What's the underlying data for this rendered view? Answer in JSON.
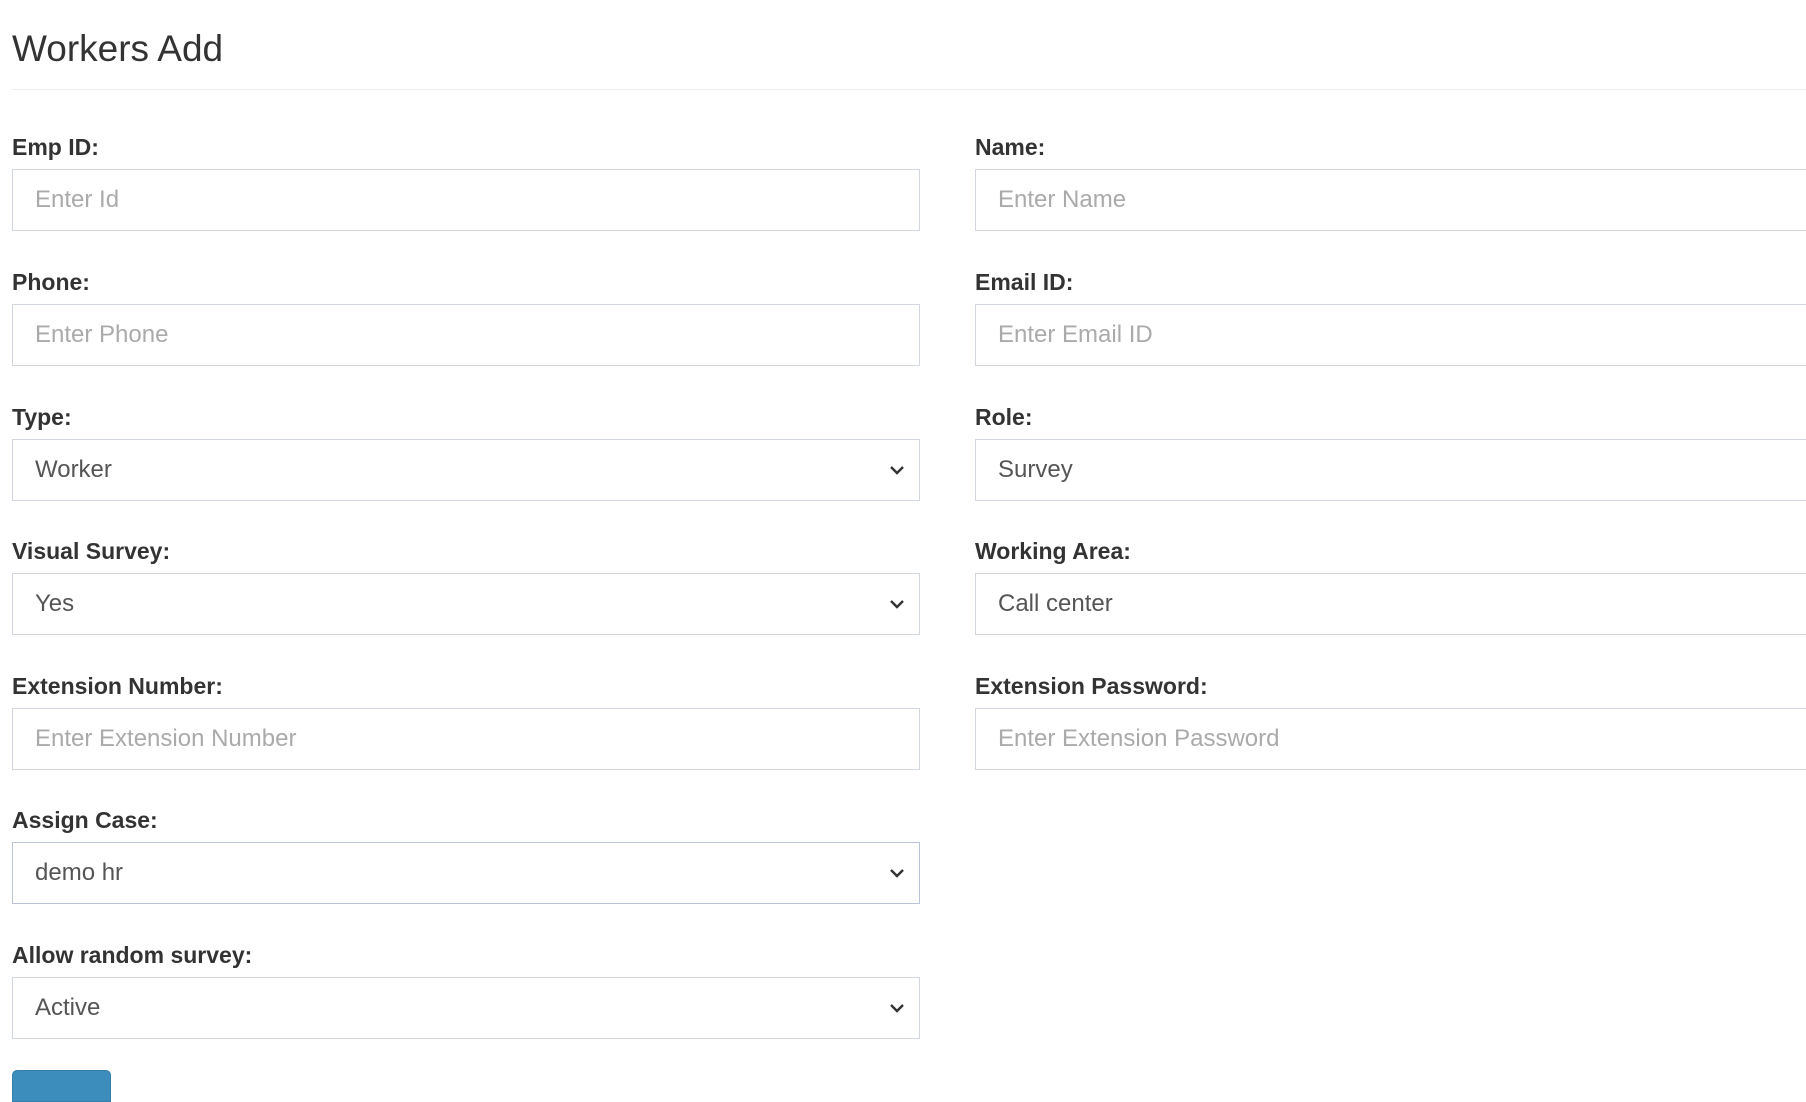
{
  "page": {
    "title": "Workers Add"
  },
  "form": {
    "emp_id": {
      "label": "Emp ID:",
      "placeholder": "Enter Id"
    },
    "name": {
      "label": "Name:",
      "placeholder": "Enter Name"
    },
    "phone": {
      "label": "Phone:",
      "placeholder": "Enter Phone"
    },
    "email": {
      "label": "Email ID:",
      "placeholder": "Enter Email ID"
    },
    "type": {
      "label": "Type:",
      "value": "Worker"
    },
    "role": {
      "label": "Role:",
      "value": "Survey"
    },
    "visual_survey": {
      "label": "Visual Survey:",
      "value": "Yes"
    },
    "working_area": {
      "label": "Working Area:",
      "value": "Call center"
    },
    "ext_number": {
      "label": "Extension Number:",
      "placeholder": "Enter Extension Number"
    },
    "ext_password": {
      "label": "Extension Password:",
      "placeholder": "Enter Extension Password"
    },
    "assign_case": {
      "label": "Assign Case:",
      "value": "demo hr"
    },
    "random_survey": {
      "label": "Allow random survey:",
      "value": "Active"
    }
  },
  "colors": {
    "primary": "#3c8dbc",
    "border": "#d2d6de"
  }
}
